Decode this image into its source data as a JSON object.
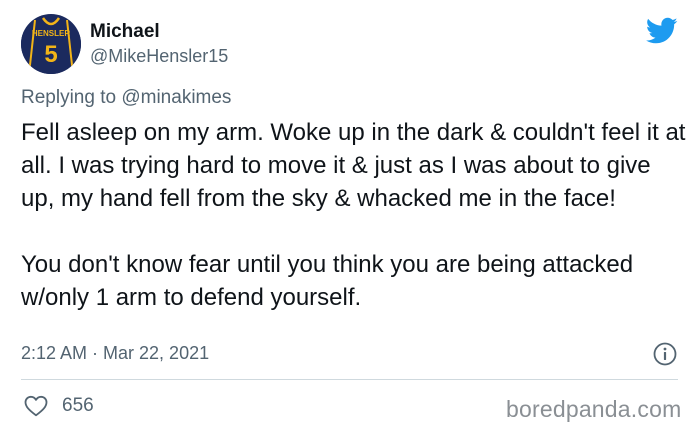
{
  "author": {
    "display_name": "Michael",
    "handle": "@MikeHensler15",
    "avatar": {
      "jersey_name": "HENSLER",
      "jersey_number": "5",
      "jersey_color": "#1b2a5e",
      "trim_color": "#f2b418"
    }
  },
  "reply": {
    "prefix": "Replying to",
    "mention": "@minakimes"
  },
  "tweet": {
    "text": "Fell asleep on my arm. Woke up in the dark & couldn't feel it at all. I was trying hard to move it & just as I was about to give up, my hand fell from the sky & whacked me in the face!\n\nYou don't know fear until you think you are being attacked w/only 1 arm to defend yourself.",
    "timestamp": "2:12 AM · Mar 22, 2021"
  },
  "engagement": {
    "likes": "656"
  },
  "icons": {
    "brand": "twitter-bird-icon",
    "info": "info-icon",
    "like": "heart-icon"
  },
  "colors": {
    "twitter_blue": "#1d9bf0",
    "secondary_text": "#536471",
    "divider": "#cfd9de"
  },
  "watermark": "boredpanda.com"
}
